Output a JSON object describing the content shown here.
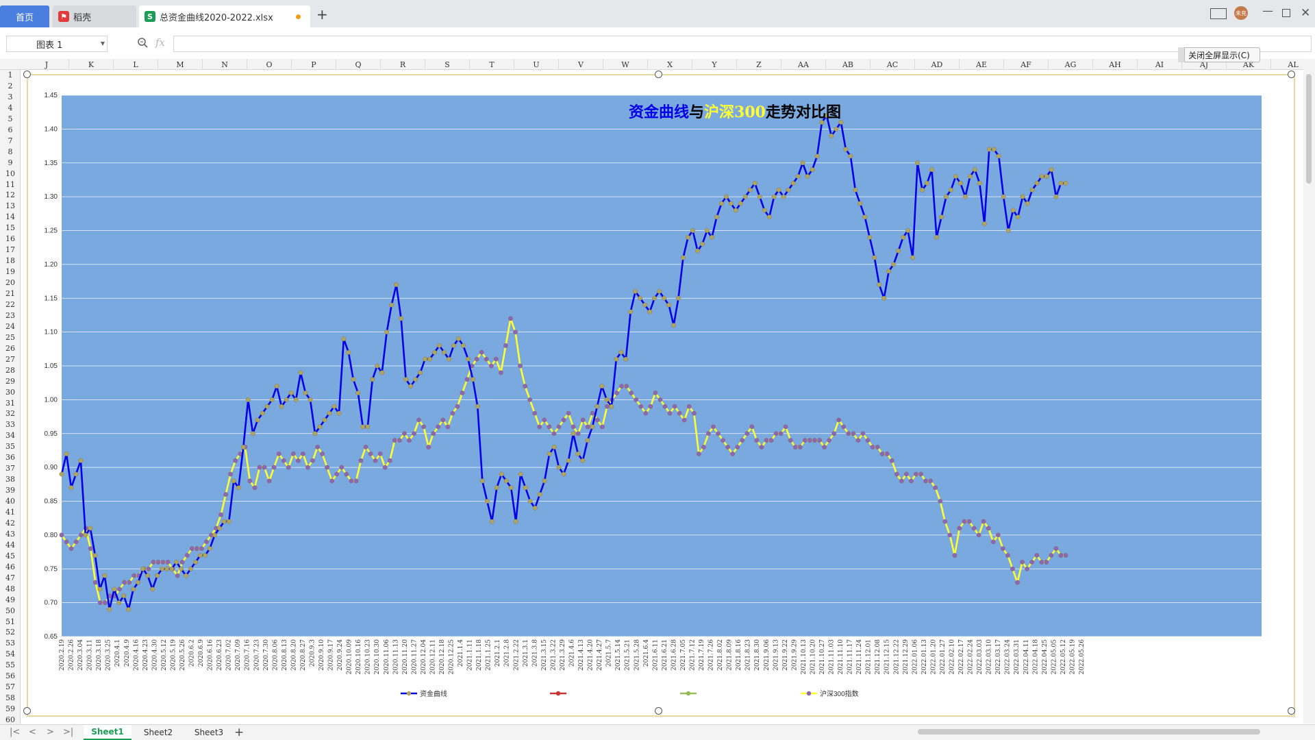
{
  "tabs": {
    "home": "首页",
    "daoke": "稻壳",
    "file": "总资金曲线2020-2022.xlsx",
    "add": "+"
  },
  "window": {
    "avatar": "未充"
  },
  "formula_bar": {
    "namebox_value": "图表 1",
    "fx_label": "fx",
    "formula_value": ""
  },
  "close_fullscreen_label": "关闭全屏显示(C)",
  "columns": [
    "J",
    "K",
    "L",
    "M",
    "N",
    "O",
    "P",
    "Q",
    "R",
    "S",
    "T",
    "U",
    "V",
    "W",
    "X",
    "Y",
    "Z",
    "AA",
    "AB",
    "AC",
    "AD",
    "AE",
    "AF",
    "AG",
    "AH",
    "AI",
    "AJ",
    "AK",
    "AL"
  ],
  "rows": [
    "1",
    "2",
    "3",
    "4",
    "5",
    "6",
    "7",
    "8",
    "9",
    "10",
    "11",
    "12",
    "13",
    "14",
    "15",
    "16",
    "17",
    "18",
    "19",
    "20",
    "21",
    "22",
    "23",
    "24",
    "25",
    "26",
    "27",
    "28",
    "29",
    "30",
    "31",
    "32",
    "33",
    "34",
    "35",
    "36",
    "37",
    "38",
    "39",
    "40",
    "41",
    "42",
    "43",
    "44",
    "45",
    "46",
    "47",
    "48",
    "49",
    "50",
    "51",
    "52",
    "53",
    "54",
    "55",
    "56",
    "57",
    "58",
    "59",
    "60"
  ],
  "sheets": [
    "Sheet1",
    "Sheet2",
    "Sheet3"
  ],
  "colors": {
    "plot_bg": "#7aa9e0",
    "fund_line": "#0000e6",
    "hs300_line": "#ffff33",
    "fund_marker": "#b0a560",
    "hs300_marker": "#8f66b0",
    "legend_red": "#cc3333",
    "legend_green": "#99bb55"
  },
  "chart_data": {
    "type": "line",
    "title_parts": [
      {
        "text": "资金曲线",
        "color": "#0000e6"
      },
      {
        "text": "与",
        "color": "#000000"
      },
      {
        "text": "沪深300",
        "color": "#ffff33"
      },
      {
        "text": "走势对比图",
        "color": "#000000"
      }
    ],
    "ylim": [
      0.65,
      1.45
    ],
    "yticks": [
      "0.65",
      "0.70",
      "0.75",
      "0.80",
      "0.85",
      "0.90",
      "0.95",
      "1.00",
      "1.05",
      "1.10",
      "1.15",
      "1.20",
      "1.25",
      "1.30",
      "1.35",
      "1.40",
      "1.45"
    ],
    "xticks": [
      "2020.2.19",
      "2020.2.26",
      "2020.3.04",
      "2020.3.11",
      "2020.3.18",
      "2020.3.25",
      "2020.4.1",
      "2020.4.9",
      "2020.4.16",
      "2020.4.23",
      "2020.4.30",
      "2020.5.12",
      "2020.5.19",
      "2020.5.26",
      "2020.6.2",
      "2020.6.9",
      "2020.6.16",
      "2020.6.23",
      "2020.7.02",
      "2020.7.09",
      "2020.7.16",
      "2020.7.23",
      "2020.7.30",
      "2020.8.06",
      "2020.8.13",
      "2020.8.20",
      "2020.8.27",
      "2020.9.3",
      "2020.9.10",
      "2020.9.17",
      "2020.9.24",
      "2020.10.09",
      "2020.10.16",
      "2020.10.23",
      "2020.10.30",
      "2020.11.06",
      "2020.11.13",
      "2020.11.20",
      "2020.11.27",
      "2020.12.04",
      "2020.12.11",
      "2020.12.18",
      "2020.12.25",
      "2021.1.4",
      "2021.1.11",
      "2021.1.18",
      "2021.1.25",
      "2021.2.1",
      "2021.2.8",
      "2021.2.22",
      "2021.3.1",
      "2021.3.8",
      "2021.3.15",
      "2021.3.22",
      "2021.3.29",
      "2021.4.6",
      "2021.4.13",
      "2021.4.20",
      "2021.4.27",
      "2021.5.7",
      "2021.5.14",
      "2021.5.21",
      "2021.5.28",
      "2021.6.4",
      "2021.6.11",
      "2021.6.21",
      "2021.6.28",
      "2021.7.05",
      "2021.7.12",
      "2021.7.19",
      "2021.7.26",
      "2021.8.02",
      "2021.8.09",
      "2021.8.16",
      "2021.8.23",
      "2021.8.30",
      "2021.9.06",
      "2021.9.13",
      "2021.9.22",
      "2021.9.29",
      "2021.10.13",
      "2021.10.20",
      "2021.10.27",
      "2021.11.03",
      "2021.11.10",
      "2021.11.17",
      "2021.11.24",
      "2021.12.01",
      "2021.12.08",
      "2021.12.15",
      "2021.12.22",
      "2021.12.29",
      "2022.01.06",
      "2022.01.13",
      "2022.01.20",
      "2022.01.27",
      "2022.02.10",
      "2022.02.17",
      "2022.02.24",
      "2022.03.03",
      "2022.03.10",
      "2022.03.17",
      "2022.03.24",
      "2022.03.31",
      "2022.04.11",
      "2022.04.18",
      "2022.04.25",
      "2022.05.05",
      "2022.05.12",
      "2022.05.19",
      "2022.05.26"
    ],
    "series": [
      {
        "name": "资金曲线",
        "values": [
          0.89,
          0.92,
          0.87,
          0.89,
          0.91,
          0.8,
          0.81,
          0.77,
          0.72,
          0.74,
          0.69,
          0.72,
          0.7,
          0.71,
          0.69,
          0.72,
          0.73,
          0.75,
          0.74,
          0.72,
          0.74,
          0.75,
          0.75,
          0.75,
          0.76,
          0.75,
          0.74,
          0.75,
          0.76,
          0.77,
          0.77,
          0.78,
          0.8,
          0.81,
          0.82,
          0.82,
          0.88,
          0.87,
          0.93,
          1.0,
          0.95,
          0.97,
          0.98,
          0.99,
          1.0,
          1.02,
          0.99,
          1.0,
          1.01,
          1.0,
          1.04,
          1.01,
          1.0,
          0.95,
          0.96,
          0.97,
          0.98,
          0.99,
          0.98,
          1.09,
          1.07,
          1.03,
          1.01,
          0.96,
          0.96,
          1.03,
          1.05,
          1.04,
          1.1,
          1.14,
          1.17,
          1.12,
          1.03,
          1.02,
          1.03,
          1.04,
          1.06,
          1.06,
          1.07,
          1.08,
          1.07,
          1.06,
          1.08,
          1.09,
          1.08,
          1.06,
          1.03,
          0.99,
          0.88,
          0.85,
          0.82,
          0.87,
          0.89,
          0.88,
          0.87,
          0.82,
          0.89,
          0.87,
          0.85,
          0.84,
          0.86,
          0.88,
          0.92,
          0.93,
          0.9,
          0.89,
          0.91,
          0.95,
          0.92,
          0.91,
          0.94,
          0.96,
          0.99,
          1.02,
          1.0,
          0.99,
          1.06,
          1.07,
          1.06,
          1.13,
          1.16,
          1.15,
          1.14,
          1.13,
          1.15,
          1.16,
          1.15,
          1.14,
          1.11,
          1.15,
          1.21,
          1.24,
          1.25,
          1.22,
          1.23,
          1.25,
          1.24,
          1.27,
          1.29,
          1.3,
          1.29,
          1.28,
          1.29,
          1.3,
          1.31,
          1.32,
          1.3,
          1.28,
          1.27,
          1.3,
          1.31,
          1.3,
          1.31,
          1.32,
          1.33,
          1.35,
          1.33,
          1.34,
          1.36,
          1.41,
          1.42,
          1.39,
          1.4,
          1.41,
          1.37,
          1.36,
          1.31,
          1.29,
          1.27,
          1.24,
          1.21,
          1.17,
          1.15,
          1.19,
          1.2,
          1.22,
          1.24,
          1.25,
          1.21,
          1.35,
          1.31,
          1.32,
          1.34,
          1.24,
          1.27,
          1.3,
          1.31,
          1.33,
          1.32,
          1.3,
          1.33,
          1.34,
          1.32,
          1.26,
          1.37,
          1.37,
          1.36,
          1.3,
          1.25,
          1.28,
          1.27,
          1.3,
          1.29,
          1.31,
          1.32,
          1.33,
          1.33,
          1.34,
          1.3,
          1.32,
          1.32
        ],
        "color": "#0000e6"
      },
      {
        "name": "沪深300指数",
        "values": [
          0.8,
          0.79,
          0.78,
          0.79,
          0.8,
          0.81,
          0.78,
          0.73,
          0.7,
          0.7,
          0.71,
          0.71,
          0.72,
          0.73,
          0.73,
          0.74,
          0.74,
          0.75,
          0.75,
          0.76,
          0.76,
          0.76,
          0.76,
          0.75,
          0.74,
          0.76,
          0.77,
          0.78,
          0.78,
          0.78,
          0.79,
          0.8,
          0.81,
          0.83,
          0.86,
          0.89,
          0.91,
          0.92,
          0.93,
          0.88,
          0.87,
          0.9,
          0.9,
          0.88,
          0.9,
          0.92,
          0.91,
          0.9,
          0.92,
          0.91,
          0.92,
          0.9,
          0.91,
          0.93,
          0.92,
          0.9,
          0.88,
          0.89,
          0.9,
          0.89,
          0.88,
          0.88,
          0.91,
          0.93,
          0.92,
          0.91,
          0.92,
          0.9,
          0.91,
          0.94,
          0.94,
          0.95,
          0.94,
          0.95,
          0.97,
          0.96,
          0.93,
          0.95,
          0.96,
          0.97,
          0.96,
          0.98,
          0.99,
          1.01,
          1.03,
          1.05,
          1.06,
          1.07,
          1.06,
          1.05,
          1.06,
          1.04,
          1.08,
          1.12,
          1.1,
          1.05,
          1.02,
          1.0,
          0.98,
          0.96,
          0.97,
          0.96,
          0.95,
          0.96,
          0.97,
          0.98,
          0.96,
          0.95,
          0.97,
          0.96,
          0.98,
          0.97,
          0.96,
          0.99,
          1.0,
          1.01,
          1.02,
          1.02,
          1.01,
          1.0,
          0.99,
          0.98,
          0.99,
          1.01,
          1.0,
          0.99,
          0.98,
          0.99,
          0.98,
          0.97,
          0.99,
          0.98,
          0.92,
          0.93,
          0.95,
          0.96,
          0.95,
          0.94,
          0.93,
          0.92,
          0.93,
          0.94,
          0.95,
          0.96,
          0.94,
          0.93,
          0.94,
          0.94,
          0.95,
          0.95,
          0.96,
          0.94,
          0.93,
          0.93,
          0.94,
          0.94,
          0.94,
          0.94,
          0.93,
          0.94,
          0.95,
          0.97,
          0.96,
          0.95,
          0.95,
          0.94,
          0.95,
          0.94,
          0.93,
          0.93,
          0.92,
          0.92,
          0.91,
          0.89,
          0.88,
          0.89,
          0.88,
          0.89,
          0.89,
          0.88,
          0.88,
          0.87,
          0.85,
          0.82,
          0.8,
          0.77,
          0.81,
          0.82,
          0.82,
          0.81,
          0.8,
          0.82,
          0.81,
          0.79,
          0.8,
          0.78,
          0.77,
          0.75,
          0.73,
          0.76,
          0.75,
          0.76,
          0.77,
          0.76,
          0.76,
          0.77,
          0.78,
          0.77,
          0.77
        ],
        "color": "#ffff33"
      }
    ],
    "legend": [
      {
        "label": "资金曲线",
        "color": "#0000e6",
        "marker": "#b0a560"
      },
      {
        "label": "",
        "color": "#cc3333",
        "marker": "#cc3333"
      },
      {
        "label": "",
        "color": "#99bb55",
        "marker": "#99bb55"
      },
      {
        "label": "沪深300指数",
        "color": "#ffff33",
        "marker": "#8f66b0"
      }
    ],
    "grid": true,
    "legend_placement": "bottom"
  }
}
